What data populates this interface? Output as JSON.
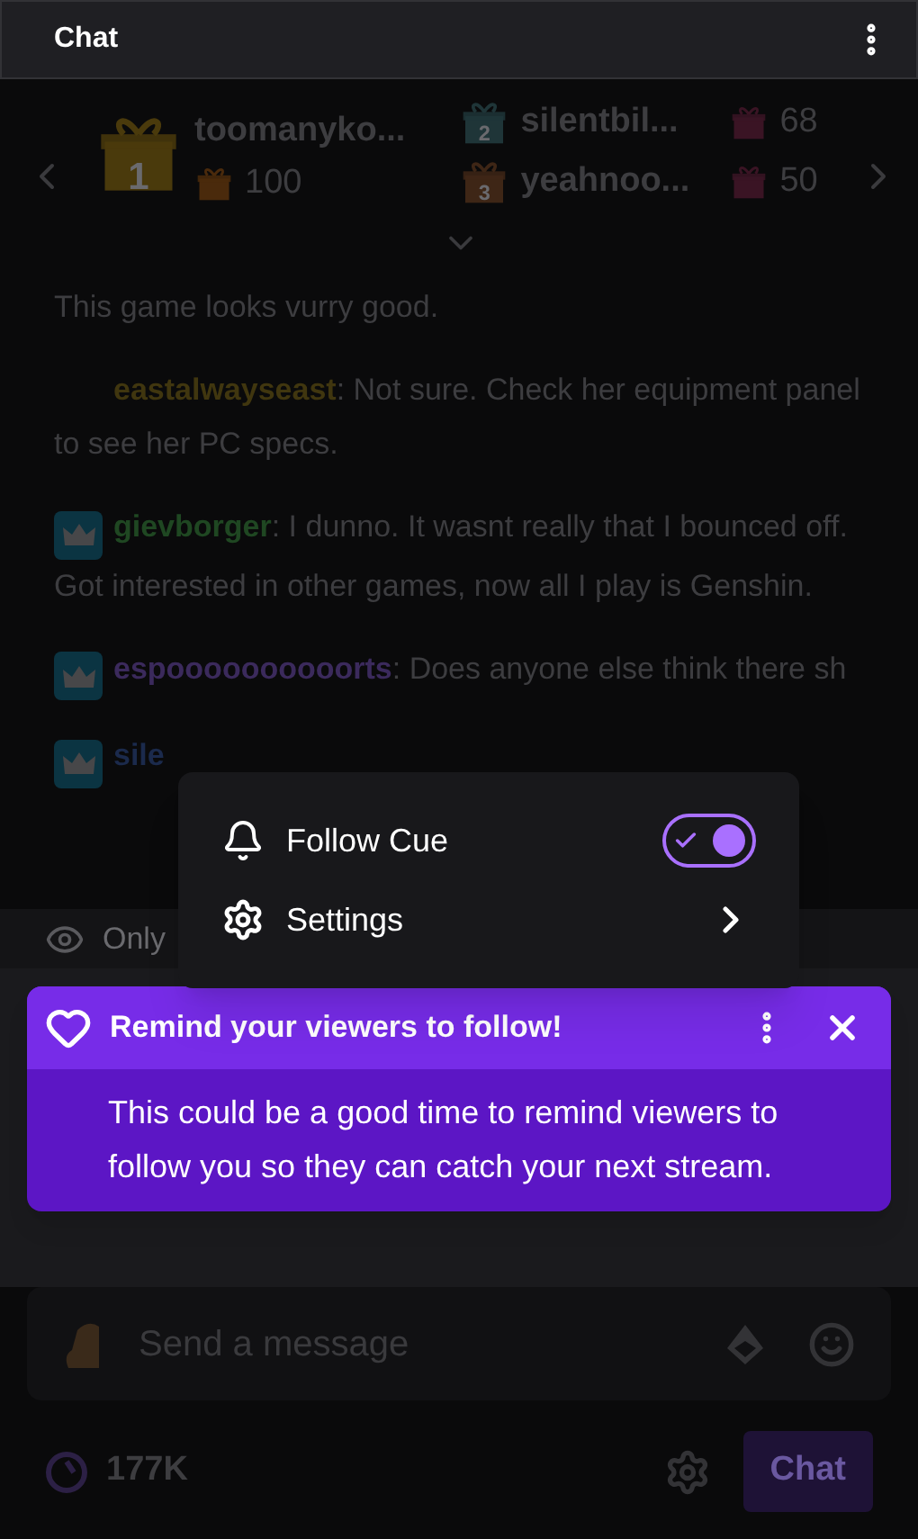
{
  "header": {
    "title": "Chat"
  },
  "leaderboard": {
    "entries": [
      {
        "rank": "1",
        "name": "toomanyko...",
        "count": "100"
      },
      {
        "rank": "2",
        "name": "silentbil...",
        "count": "68"
      },
      {
        "rank": "3",
        "name": "yeahnoo...",
        "count": "50"
      }
    ]
  },
  "messages": [
    {
      "kind": "continuation",
      "text": "This game looks vurry good."
    },
    {
      "kind": "chat",
      "badge": false,
      "user": "eastalwayseast",
      "color": "#40360f",
      "text": ": Not sure. Check her equipment panel to see her PC specs."
    },
    {
      "kind": "chat",
      "badge": true,
      "user": "gievborger",
      "color": "#1f4722",
      "text": ": I dunno. It wasnt really that I bounced off. Got interested in other games, now all I play is Genshin."
    },
    {
      "kind": "chat",
      "badge": true,
      "user": "espoooooooooorts",
      "color": "#3b2a5c",
      "text": ": Does anyone else think there sh"
    },
    {
      "kind": "chat",
      "badge": true,
      "user": "sile",
      "color": "#1b2a4c"
    }
  ],
  "filter_bar": {
    "label": "Only"
  },
  "menu": {
    "items": [
      {
        "kind": "toggle",
        "label": "Follow Cue",
        "on": true
      },
      {
        "kind": "submenu",
        "label": "Settings"
      }
    ]
  },
  "cue": {
    "title": "Remind your viewers to follow!",
    "body": "This could be a good time to remind viewers to follow you so they can catch your next stream."
  },
  "composer": {
    "placeholder": "Send a message"
  },
  "footer": {
    "points": "177K",
    "send": "Chat"
  }
}
